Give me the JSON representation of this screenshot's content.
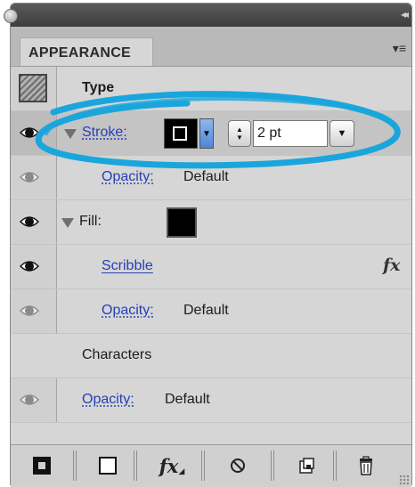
{
  "panel": {
    "tab_label": "APPEARANCE",
    "collapse_glyph": "◂◂",
    "menu_glyph": "▾≡"
  },
  "rows": {
    "type": {
      "label": "Type"
    },
    "stroke": {
      "label": "Stroke:",
      "weight_value": "2 pt",
      "color": "#000000"
    },
    "stroke_opacity": {
      "label": "Opacity:",
      "value": "Default"
    },
    "fill": {
      "label": "Fill:",
      "color": "#000000"
    },
    "scribble": {
      "label": "Scribble",
      "fx": "fx"
    },
    "fill_opacity": {
      "label": "Opacity:",
      "value": "Default"
    },
    "characters": {
      "label": "Characters"
    },
    "char_opacity": {
      "label": "Opacity:",
      "value": "Default"
    }
  },
  "annotation": {
    "color": "#1aa6dc"
  },
  "bottom_toolbar": {
    "icons": [
      "stroke-box-icon",
      "fill-box-icon",
      "fx-icon",
      "clear-icon",
      "duplicate-icon",
      "trash-icon"
    ],
    "fx_label": "fx"
  }
}
